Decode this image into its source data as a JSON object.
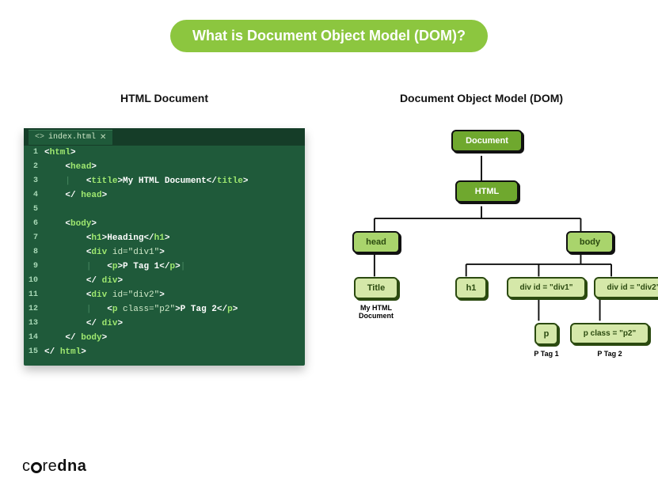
{
  "title": "What is Document Object Model (DOM)?",
  "left_header": "HTML Document",
  "right_header": "Document Object Model (DOM)",
  "editor": {
    "filename": "index.html",
    "lines": [
      {
        "n": "1",
        "indent": 0,
        "kind": "open",
        "tag": "html"
      },
      {
        "n": "2",
        "indent": 1,
        "kind": "open",
        "tag": "head"
      },
      {
        "n": "3",
        "indent": 2,
        "kind": "pipe_wrap",
        "tag": "title",
        "text": "My HTML Document"
      },
      {
        "n": "4",
        "indent": 1,
        "kind": "close",
        "tag": "head"
      },
      {
        "n": "5",
        "indent": 0,
        "kind": "blank"
      },
      {
        "n": "6",
        "indent": 1,
        "kind": "open",
        "tag": "body"
      },
      {
        "n": "7",
        "indent": 2,
        "kind": "wrap",
        "tag": "h1",
        "text": "Heading"
      },
      {
        "n": "8",
        "indent": 2,
        "kind": "open_attr",
        "tag": "div",
        "attr": "id=\"div1\""
      },
      {
        "n": "9",
        "indent": 3,
        "kind": "pipe_wrap_cursor",
        "tag": "p",
        "text": "P Tag 1"
      },
      {
        "n": "10",
        "indent": 2,
        "kind": "close",
        "tag": "div"
      },
      {
        "n": "11",
        "indent": 2,
        "kind": "open_attr",
        "tag": "div",
        "attr": "id=\"div2\""
      },
      {
        "n": "12",
        "indent": 3,
        "kind": "pipe_wrap_attr",
        "tag": "p",
        "attr": "class=\"p2\"",
        "text": "P Tag 2"
      },
      {
        "n": "13",
        "indent": 2,
        "kind": "close",
        "tag": "div"
      },
      {
        "n": "14",
        "indent": 1,
        "kind": "close",
        "tag": "body"
      },
      {
        "n": "15",
        "indent": 0,
        "kind": "close",
        "tag": "html"
      }
    ]
  },
  "tree": {
    "document": "Document",
    "html": "HTML",
    "head": "head",
    "body": "body",
    "title": "Title",
    "h1": "h1",
    "div1": "div id = \"div1\"",
    "div2": "div id = \"div2\"",
    "p": "p",
    "p2": "p class = \"p2\"",
    "caption_title": "My HTML Document",
    "caption_p1": "P Tag 1",
    "caption_p2": "P Tag 2"
  },
  "logo": {
    "pre": "c",
    "post": "re ",
    "bold": "dna"
  }
}
